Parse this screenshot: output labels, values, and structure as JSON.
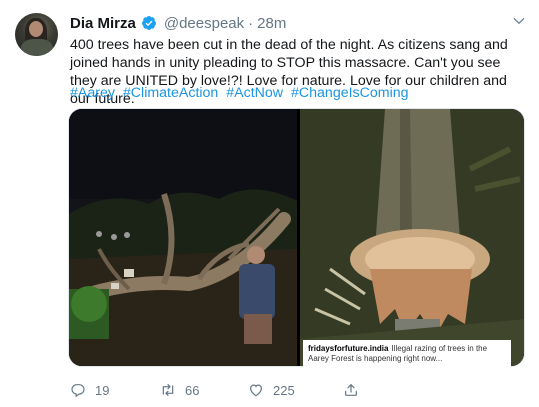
{
  "tweet": {
    "author_name": "Dia Mirza",
    "handle": "@deespeak",
    "separator": "·",
    "time": "28m",
    "text": "400 trees have been cut in the dead of the night. As citizens sang and joined hands in unity pleading to STOP this massacre. Can't you see they are UNITED by love!?! Love for nature. Love for our children and our future.",
    "hashtags": [
      "#Aarey",
      "#ClimateAction",
      "#ActNow",
      "#ChangeIsComing"
    ]
  },
  "media": {
    "caption_account": "fridaysforfuture.india",
    "caption_text": "Illegal razing of trees in the Aarey Forest is happening right now..."
  },
  "actions": {
    "reply_count": "19",
    "retweet_count": "66",
    "like_count": "225"
  },
  "colors": {
    "link": "#1b95e0",
    "muted": "#657786",
    "verified": "#1da1f2"
  },
  "icons": [
    "verified-badge-icon",
    "chevron-down-icon",
    "reply-icon",
    "retweet-icon",
    "like-icon",
    "share-icon"
  ]
}
